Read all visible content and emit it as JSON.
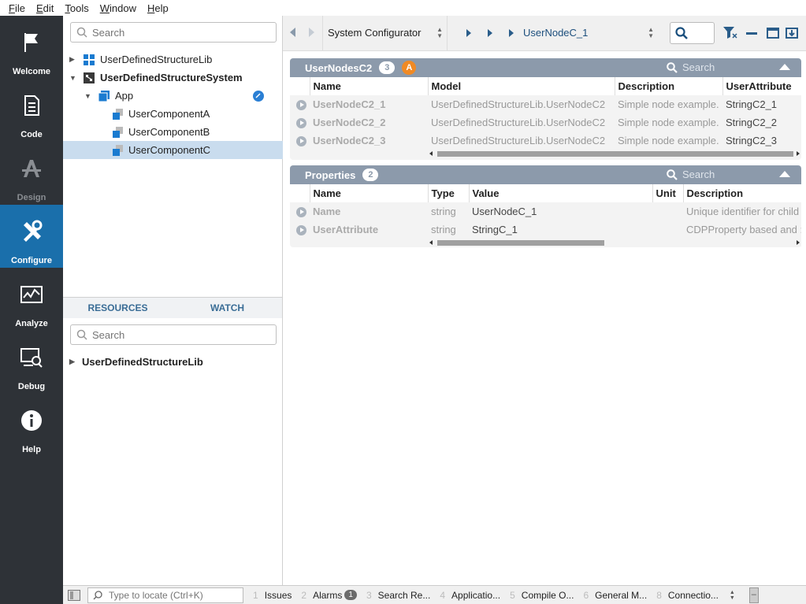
{
  "menu": [
    "File",
    "Edit",
    "Tools",
    "Window",
    "Help"
  ],
  "modes": [
    {
      "label": "Welcome",
      "icon": "flag-icon"
    },
    {
      "label": "Code",
      "icon": "document-icon"
    },
    {
      "label": "Design",
      "icon": "design-icon"
    },
    {
      "label": "Configure",
      "icon": "tools-icon"
    },
    {
      "label": "Analyze",
      "icon": "chart-icon"
    },
    {
      "label": "Debug",
      "icon": "debug-icon"
    },
    {
      "label": "Help",
      "icon": "info-icon"
    }
  ],
  "tree": {
    "search_placeholder": "Search",
    "items": [
      {
        "label": "UserDefinedStructureLib"
      },
      {
        "label": "UserDefinedStructureSystem"
      },
      {
        "label": "App"
      },
      {
        "label": "UserComponentA"
      },
      {
        "label": "UserComponentB"
      },
      {
        "label": "UserComponentC"
      }
    ]
  },
  "bottom": {
    "tabs": [
      "RESOURCES",
      "WATCH"
    ],
    "search_placeholder": "Search",
    "items": [
      {
        "label": "UserDefinedStructureLib"
      }
    ]
  },
  "toolbar": {
    "combo": "System Configurator",
    "crumb": "UserNodeC_1"
  },
  "nodes_panel": {
    "title": "UserNodesC2",
    "count": "3",
    "alarm": "A",
    "search_placeholder": "Search",
    "columns": [
      "Name",
      "Model",
      "Description",
      "UserAttribute"
    ],
    "rows": [
      [
        "UserNodeC2_1",
        "UserDefinedStructureLib.UserNodeC2",
        "Simple node example.",
        "StringC2_1"
      ],
      [
        "UserNodeC2_2",
        "UserDefinedStructureLib.UserNodeC2",
        "Simple node example.",
        "StringC2_2"
      ],
      [
        "UserNodeC2_3",
        "UserDefinedStructureLib.UserNodeC2",
        "Simple node example.",
        "StringC2_3"
      ]
    ]
  },
  "props_panel": {
    "title": "Properties",
    "count": "2",
    "search_placeholder": "Search",
    "columns": [
      "Name",
      "Type",
      "Value",
      "Unit",
      "Description"
    ],
    "rows": [
      [
        "Name",
        "string",
        "UserNodeC_1",
        "",
        "Unique identifier for child"
      ],
      [
        "UserAttribute",
        "string",
        "StringC_1",
        "",
        "CDPProperty based and :"
      ]
    ]
  },
  "statusbar": {
    "locate_placeholder": "Type to locate (Ctrl+K)",
    "items": [
      {
        "num": "1",
        "label": "Issues"
      },
      {
        "num": "2",
        "label": "Alarms",
        "count": "1"
      },
      {
        "num": "3",
        "label": "Search Re..."
      },
      {
        "num": "4",
        "label": "Applicatio..."
      },
      {
        "num": "5",
        "label": "Compile O..."
      },
      {
        "num": "6",
        "label": "General M..."
      },
      {
        "num": "8",
        "label": "Connectio..."
      }
    ]
  },
  "colors": {
    "accent": "#1a6fab",
    "sidebar": "#2e3237",
    "panel_header": "#8c9aab",
    "alarm": "#f08a24"
  }
}
